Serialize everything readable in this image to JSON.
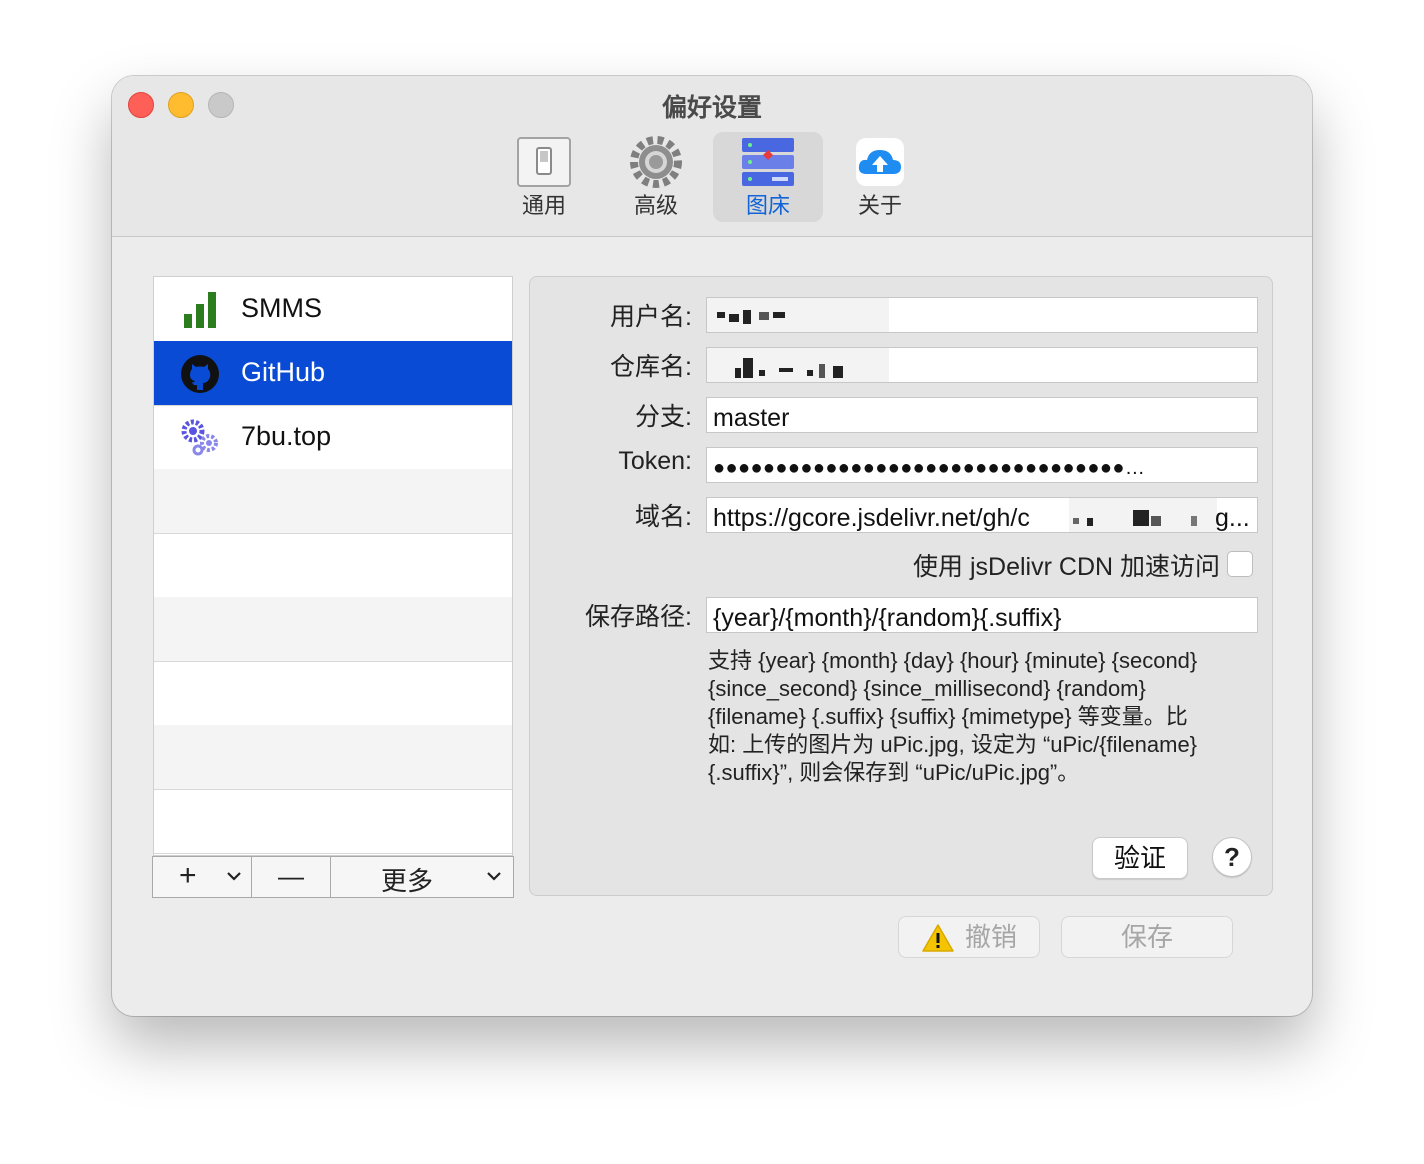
{
  "window": {
    "title": "偏好设置"
  },
  "toolbar": {
    "items": [
      {
        "label": "通用",
        "icon": "switch-icon"
      },
      {
        "label": "高级",
        "icon": "gear-icon"
      },
      {
        "label": "图床",
        "icon": "server-icon",
        "selected": true
      },
      {
        "label": "关于",
        "icon": "cloud-upload-icon"
      }
    ]
  },
  "sidebar": {
    "items": [
      {
        "label": "SMMS",
        "icon": "signal-bars-icon"
      },
      {
        "label": "GitHub",
        "icon": "github-icon",
        "selected": true
      },
      {
        "label": "7bu.top",
        "icon": "gears-icon"
      }
    ],
    "add_label": "+",
    "remove_label": "—",
    "more_label": "更多"
  },
  "form": {
    "username_label": "用户名:",
    "repo_label": "仓库名:",
    "branch_label": "分支:",
    "branch_value": "master",
    "token_label": "Token:",
    "token_value": "●●●●●●●●●●●●●●●●●●●●●●●●●●●●●●●●●…",
    "domain_label": "域名:",
    "domain_value": "https://gcore.jsdelivr.net/gh/c",
    "domain_tail": "g...",
    "cdn_label": "使用 jsDelivr CDN 加速访问",
    "path_label": "保存路径:",
    "path_value": "{year}/{month}/{random}{.suffix}",
    "help_line1": "支持 {year} {month} {day} {hour} {minute} {second}",
    "help_line2": "{since_second} {since_millisecond} {random}",
    "help_line3": "{filename} {.suffix} {suffix} {mimetype} 等变量。比",
    "help_line4": "如: 上传的图片为 uPic.jpg, 设定为 “uPic/{filename}",
    "help_line5": "{.suffix}”, 则会保存到 “uPic/uPic.jpg”。",
    "verify_label": "验证",
    "help_label": "?"
  },
  "footer": {
    "revert_label": "撤销",
    "save_label": "保存"
  },
  "colors": {
    "selection": "#0a4bd6",
    "toolbar_selected_text": "#1363d8",
    "close": "#fe5f57",
    "minimize": "#febc2e"
  }
}
